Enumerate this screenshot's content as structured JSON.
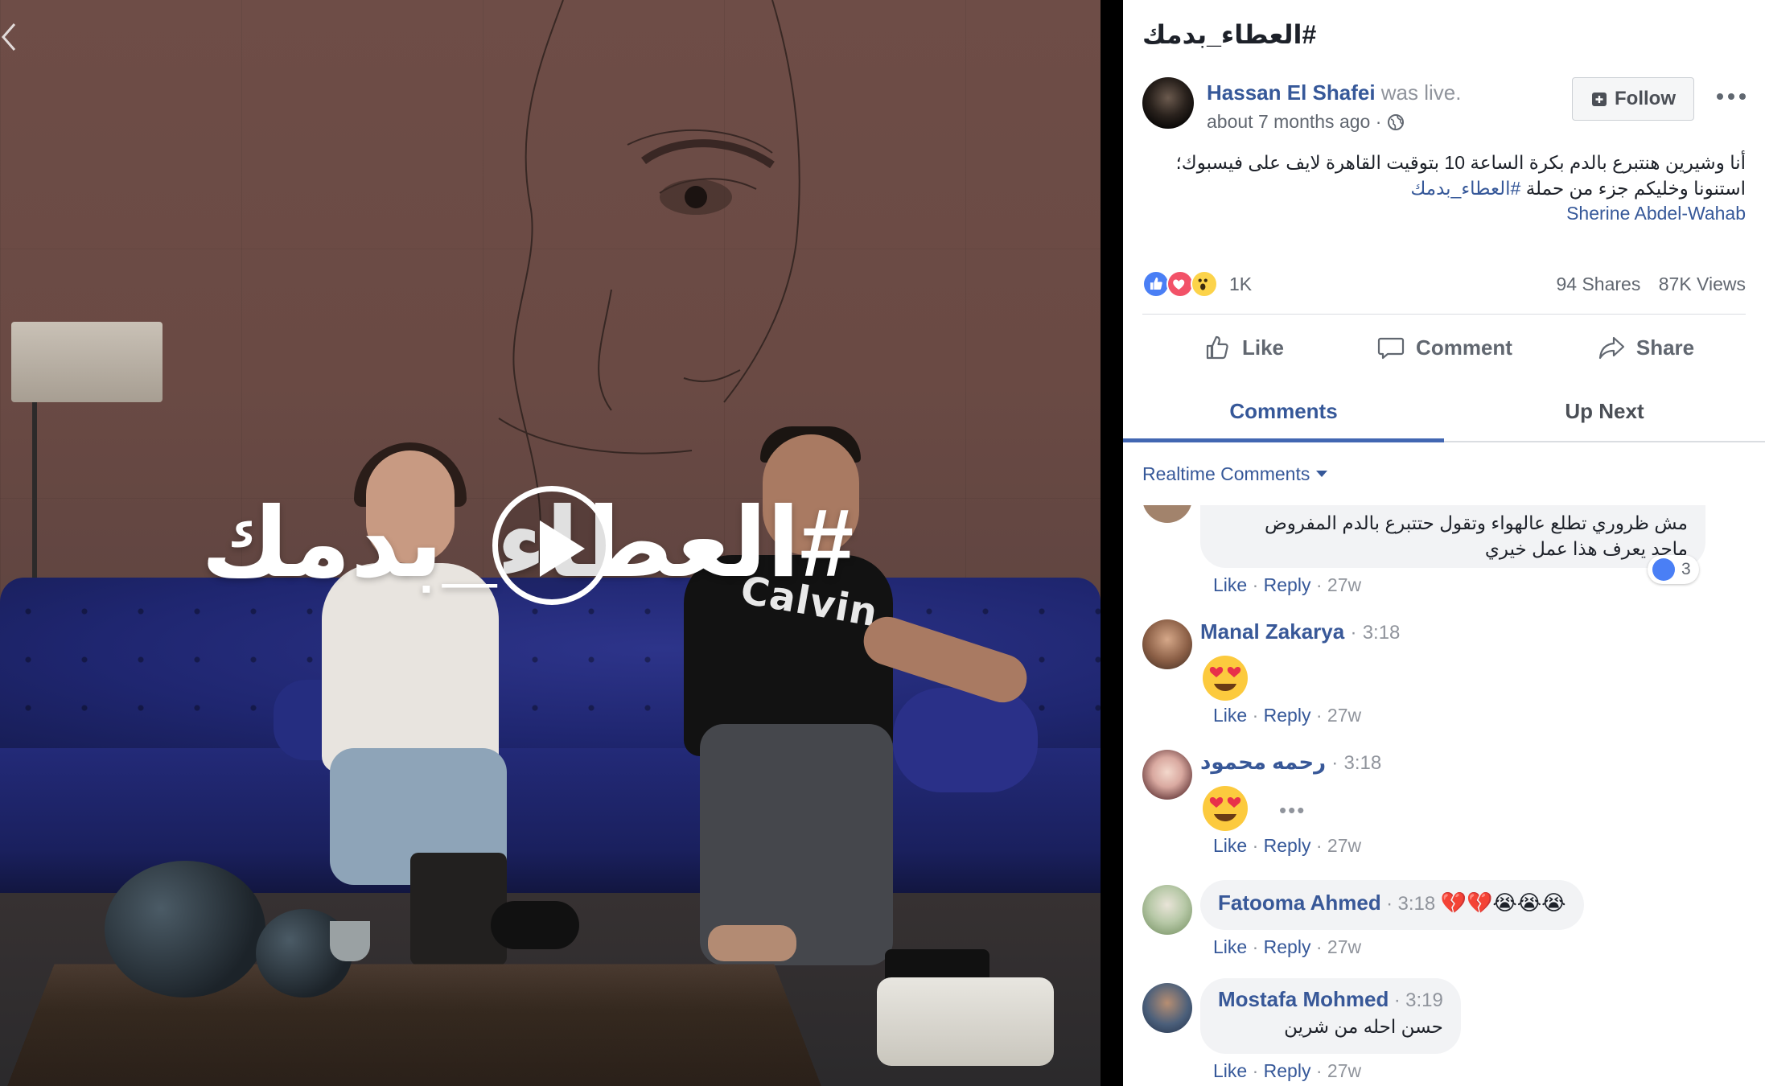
{
  "video": {
    "overlay_hashtag": "#العطاء_بدمك",
    "play_label": "Play video"
  },
  "post": {
    "title": "#العطاء_بدمك",
    "author": "Hassan El Shafei",
    "author_action": "was live.",
    "time": "about 7 months ago",
    "separator": "·",
    "follow_label": "Follow",
    "more_label": "•••",
    "body_line1": "أنا وشيرين هنتبرع بالدم بكرة الساعة 10 بتوقيت القاهرة لايف على فيسبوك؛",
    "body_line2_text": "استنونا وخليكم جزء من حملة ",
    "body_line2_link": "#العطاء_بدمك",
    "tagged": "Sherine Abdel-Wahab",
    "reaction_count": "1K",
    "shares": "94 Shares",
    "views": "87K Views",
    "actions": {
      "like": "Like",
      "comment": "Comment",
      "share": "Share"
    }
  },
  "tabs": {
    "comments": "Comments",
    "up_next": "Up Next"
  },
  "realtime_label": "Realtime Comments",
  "comments": [
    {
      "text_line1": "مش ظروري تطلع عالهواء وتقول حتتبرع بالدم المفروض",
      "text_line2": "ماحد يعرف هذا عمل خيري",
      "like_count": "3",
      "like": "Like",
      "reply": "Reply",
      "age": "27w",
      "dot": "·"
    },
    {
      "name": "Manal Zakarya",
      "time": "3:18",
      "emoji": "😍",
      "like": "Like",
      "reply": "Reply",
      "age": "27w",
      "dot": "·"
    },
    {
      "name": "رحمه محمود",
      "time": "3:18",
      "emoji": "😍",
      "more": "•••",
      "like": "Like",
      "reply": "Reply",
      "age": "27w",
      "dot": "·"
    },
    {
      "name": "Fatooma Ahmed",
      "time": "3:18",
      "emojis": "💔💔😭😭😭",
      "like": "Like",
      "reply": "Reply",
      "age": "27w",
      "dot": "·"
    },
    {
      "name": "Mostafa Mohmed",
      "time": "3:19",
      "text": "حسن احله من شرين",
      "like": "Like",
      "reply": "Reply",
      "age": "27w",
      "dot": "·"
    }
  ],
  "colors": {
    "link_blue": "#365899",
    "tab_underline": "#4267b2",
    "like_blue": "#4a7ff5",
    "love_red": "#f25268",
    "wow_yellow": "#fcd34a",
    "sofa_blue": "#232a78"
  }
}
